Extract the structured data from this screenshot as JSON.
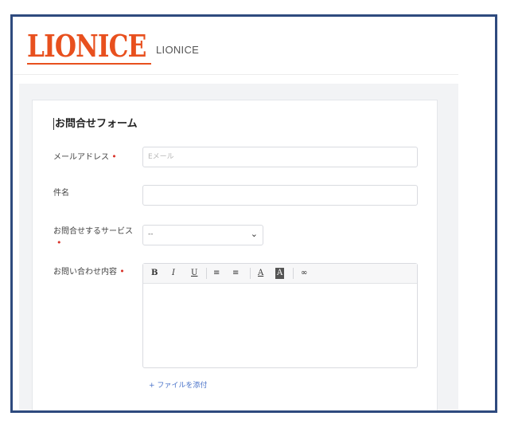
{
  "header": {
    "logo_mark": "LIONICE",
    "logo_text": "LIONICE"
  },
  "form": {
    "title": "お問合せフォーム",
    "required_mark": "•",
    "email": {
      "label": "メールアドレス",
      "placeholder": "Eメール"
    },
    "subject": {
      "label": "件名",
      "value": ""
    },
    "service": {
      "label": "お問合せするサービス",
      "selected": "--"
    },
    "message": {
      "label": "お問い合わせ内容"
    },
    "toolbar": {
      "bold": "B",
      "italic": "I",
      "underline": "U",
      "bullet_list": "≡",
      "numbered_list": "≡",
      "font_color": "A",
      "bg_color": "A",
      "link": "∞"
    },
    "attach_label": "+ ファイルを添付"
  },
  "colors": {
    "brand": "#e8501e",
    "frame_border": "#2e4a7e",
    "link": "#4a73c9",
    "required": "#d9342b"
  }
}
